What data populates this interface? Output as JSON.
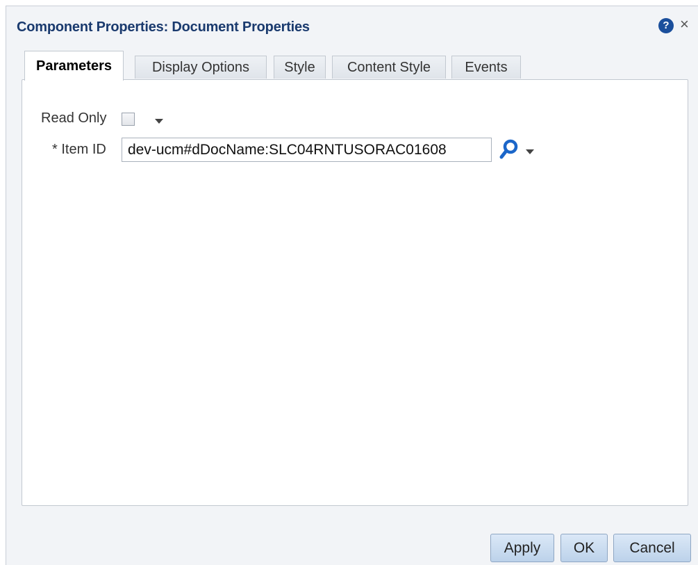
{
  "dialog": {
    "title": "Component Properties: Document Properties",
    "help_icon": "question-circle-icon",
    "close_label": "×"
  },
  "tabs": [
    {
      "label": "Parameters",
      "active": true
    },
    {
      "label": "Display Options",
      "active": false
    },
    {
      "label": "Style",
      "active": false
    },
    {
      "label": "Content Style",
      "active": false
    },
    {
      "label": "Events",
      "active": false
    }
  ],
  "parameters": {
    "read_only": {
      "label": "Read Only",
      "checked": false
    },
    "item_id": {
      "required_marker": "*",
      "label": "Item ID",
      "value": "dev-ucm#dDocName:SLC04RNTUSORAC01608"
    }
  },
  "footer": {
    "apply_label": "Apply",
    "ok_label": "OK",
    "cancel_label": "Cancel"
  },
  "colors": {
    "title": "#1a3a6e",
    "accent_icon": "#1b66c9",
    "button_bg": "#c9dcf0"
  }
}
